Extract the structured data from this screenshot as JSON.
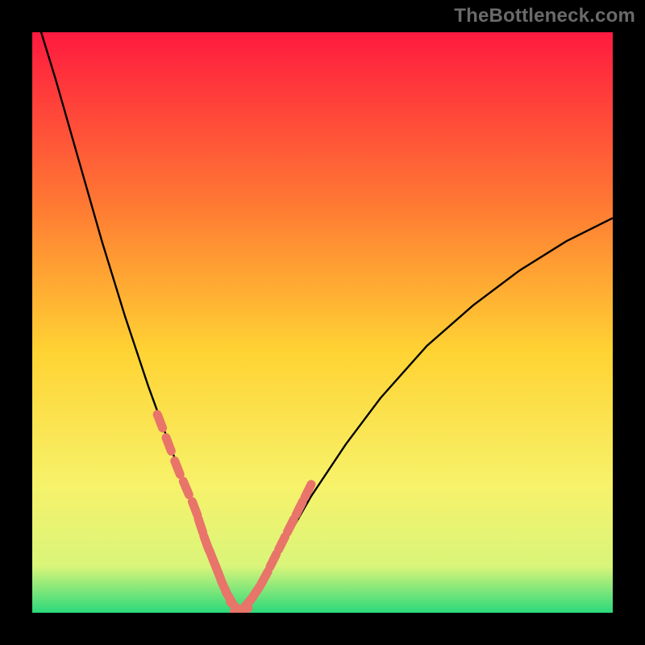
{
  "watermark": "TheBottleneck.com",
  "colors": {
    "frame": "#000000",
    "gradient_top": "#ff1a3f",
    "gradient_mid1": "#ff7a33",
    "gradient_mid2": "#ffd333",
    "gradient_mid3": "#f7f26a",
    "gradient_low": "#d9f57a",
    "gradient_base": "#2bd97b",
    "curve": "#000000",
    "marker": "#e8746a"
  },
  "chart_data": {
    "type": "line",
    "title": "",
    "xlabel": "",
    "ylabel": "",
    "xlim": [
      0,
      100
    ],
    "ylim": [
      0,
      100
    ],
    "series": [
      {
        "name": "bottleneck-curve",
        "x": [
          0,
          4,
          8,
          12,
          16,
          20,
          24,
          26,
          28,
          30,
          31,
          32,
          33,
          34,
          35,
          36,
          38,
          40,
          44,
          48,
          54,
          60,
          68,
          76,
          84,
          92,
          100
        ],
        "values": [
          105,
          92,
          78,
          64,
          51,
          39,
          28,
          23,
          18,
          13,
          10,
          7,
          4,
          2,
          1,
          0.5,
          2,
          6,
          13,
          20,
          29,
          37,
          46,
          53,
          59,
          64,
          68
        ]
      }
    ],
    "markers": {
      "name": "highlight-dots",
      "x": [
        22,
        23.5,
        25,
        26.5,
        28,
        29,
        30,
        31,
        32,
        33,
        34,
        35,
        36,
        37,
        38.5,
        40,
        41.5,
        43,
        44.5,
        46,
        47.5
      ],
      "values": [
        33,
        29,
        25,
        21.5,
        18,
        15,
        12,
        9.5,
        7,
        4.5,
        2.5,
        1,
        0.5,
        1.5,
        3.5,
        6,
        9,
        12,
        15,
        18,
        21
      ]
    },
    "optimum_x": 35
  }
}
